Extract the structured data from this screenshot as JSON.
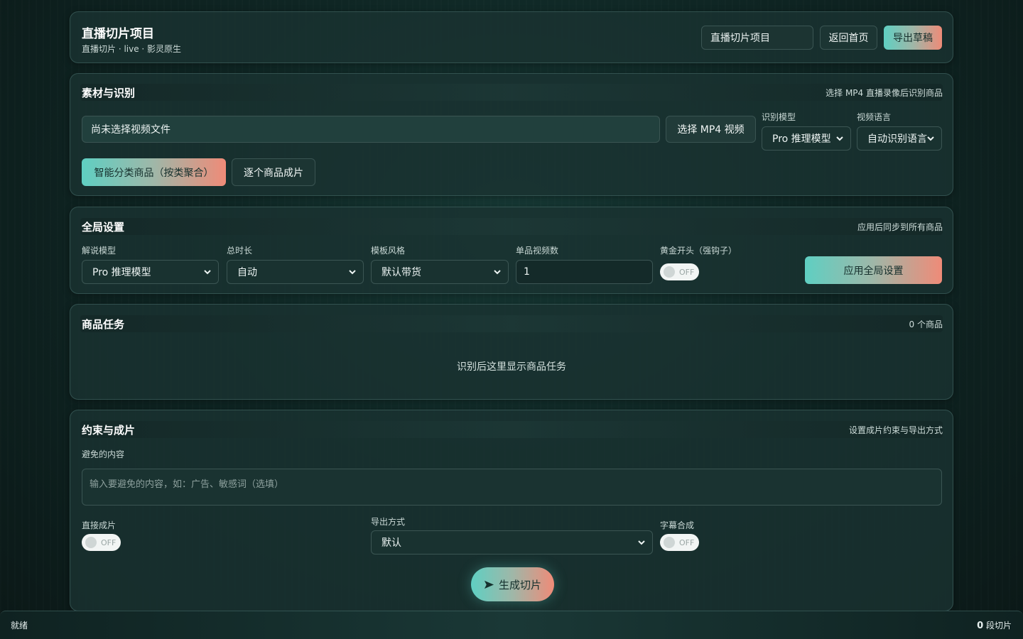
{
  "header": {
    "title": "直播切片项目",
    "subtitle": "直播切片 · live · 影灵原生",
    "project_name_value": "直播切片项目",
    "home_label": "返回首页",
    "export_label": "导出草稿"
  },
  "material": {
    "title": "素材与识别",
    "hint": "选择 MP4 直播录像后识别商品",
    "file_placeholder": "尚未选择视频文件",
    "choose_label": "选择 MP4 视频",
    "model_label": "识别模型",
    "model_value": "Pro 推理模型",
    "lang_label": "视频语言",
    "lang_value": "自动识别语言",
    "smart_label": "智能分类商品（按类聚合）",
    "single_label": "逐个商品成片"
  },
  "global": {
    "title": "全局设置",
    "hint": "应用后同步到所有商品",
    "narration_label": "解说模型",
    "narration_value": "Pro 推理模型",
    "duration_label": "总时长",
    "duration_value": "自动",
    "template_label": "模板风格",
    "template_value": "默认带货",
    "count_label": "单品视频数",
    "count_value": "1",
    "hook_label": "黄金开头（强钩子）",
    "hook_toggle": "OFF",
    "apply_label": "应用全局设置"
  },
  "tasks": {
    "title": "商品任务",
    "count": "0 个商品",
    "empty": "识别后这里显示商品任务"
  },
  "output": {
    "title": "约束与成片",
    "hint": "设置成片约束与导出方式",
    "avoid_label": "避免的内容",
    "avoid_placeholder": "输入要避免的内容，如：广告、敏感词（选填）",
    "direct_label": "直接成片",
    "direct_toggle": "OFF",
    "export_label": "导出方式",
    "export_value": "默认",
    "subtitle_label": "字幕合成",
    "subtitle_toggle": "OFF",
    "generate_label": "生成切片"
  },
  "status": {
    "text": "就绪",
    "count": "0",
    "count_unit": "段切片"
  },
  "colors": {
    "accent_start": "#5fcfc2",
    "accent_end": "#ef8b78",
    "panel": "#1a3231"
  }
}
